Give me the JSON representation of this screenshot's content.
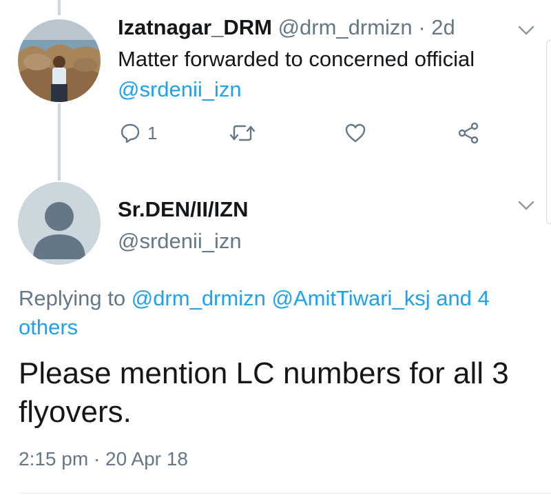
{
  "tweet1": {
    "name": "Izatnagar_DRM",
    "handle": "@drm_drmizn",
    "separator": "·",
    "time": "2d",
    "text": "Matter forwarded to concerned official",
    "mention": "@srdenii_izn",
    "reply_count": "1"
  },
  "tweet2": {
    "name": "Sr.DEN/II/IZN",
    "handle": "@srdenii_izn",
    "replying_prefix": "Replying to",
    "replying_to_1": "@drm_drmizn",
    "replying_to_2": "@AmitTiwari_ksj",
    "replying_others": "and 4 others",
    "text": "Please mention LC numbers for all 3 flyovers.",
    "timestamp": "2:15 pm · 20 Apr 18"
  },
  "colors": {
    "link": "#1da1f2",
    "muted": "#657786",
    "text": "#14171a",
    "thread_line": "#ccd6dd"
  },
  "icons": [
    "reply-icon",
    "retweet-icon",
    "like-icon",
    "share-icon",
    "chevron-down-icon"
  ]
}
